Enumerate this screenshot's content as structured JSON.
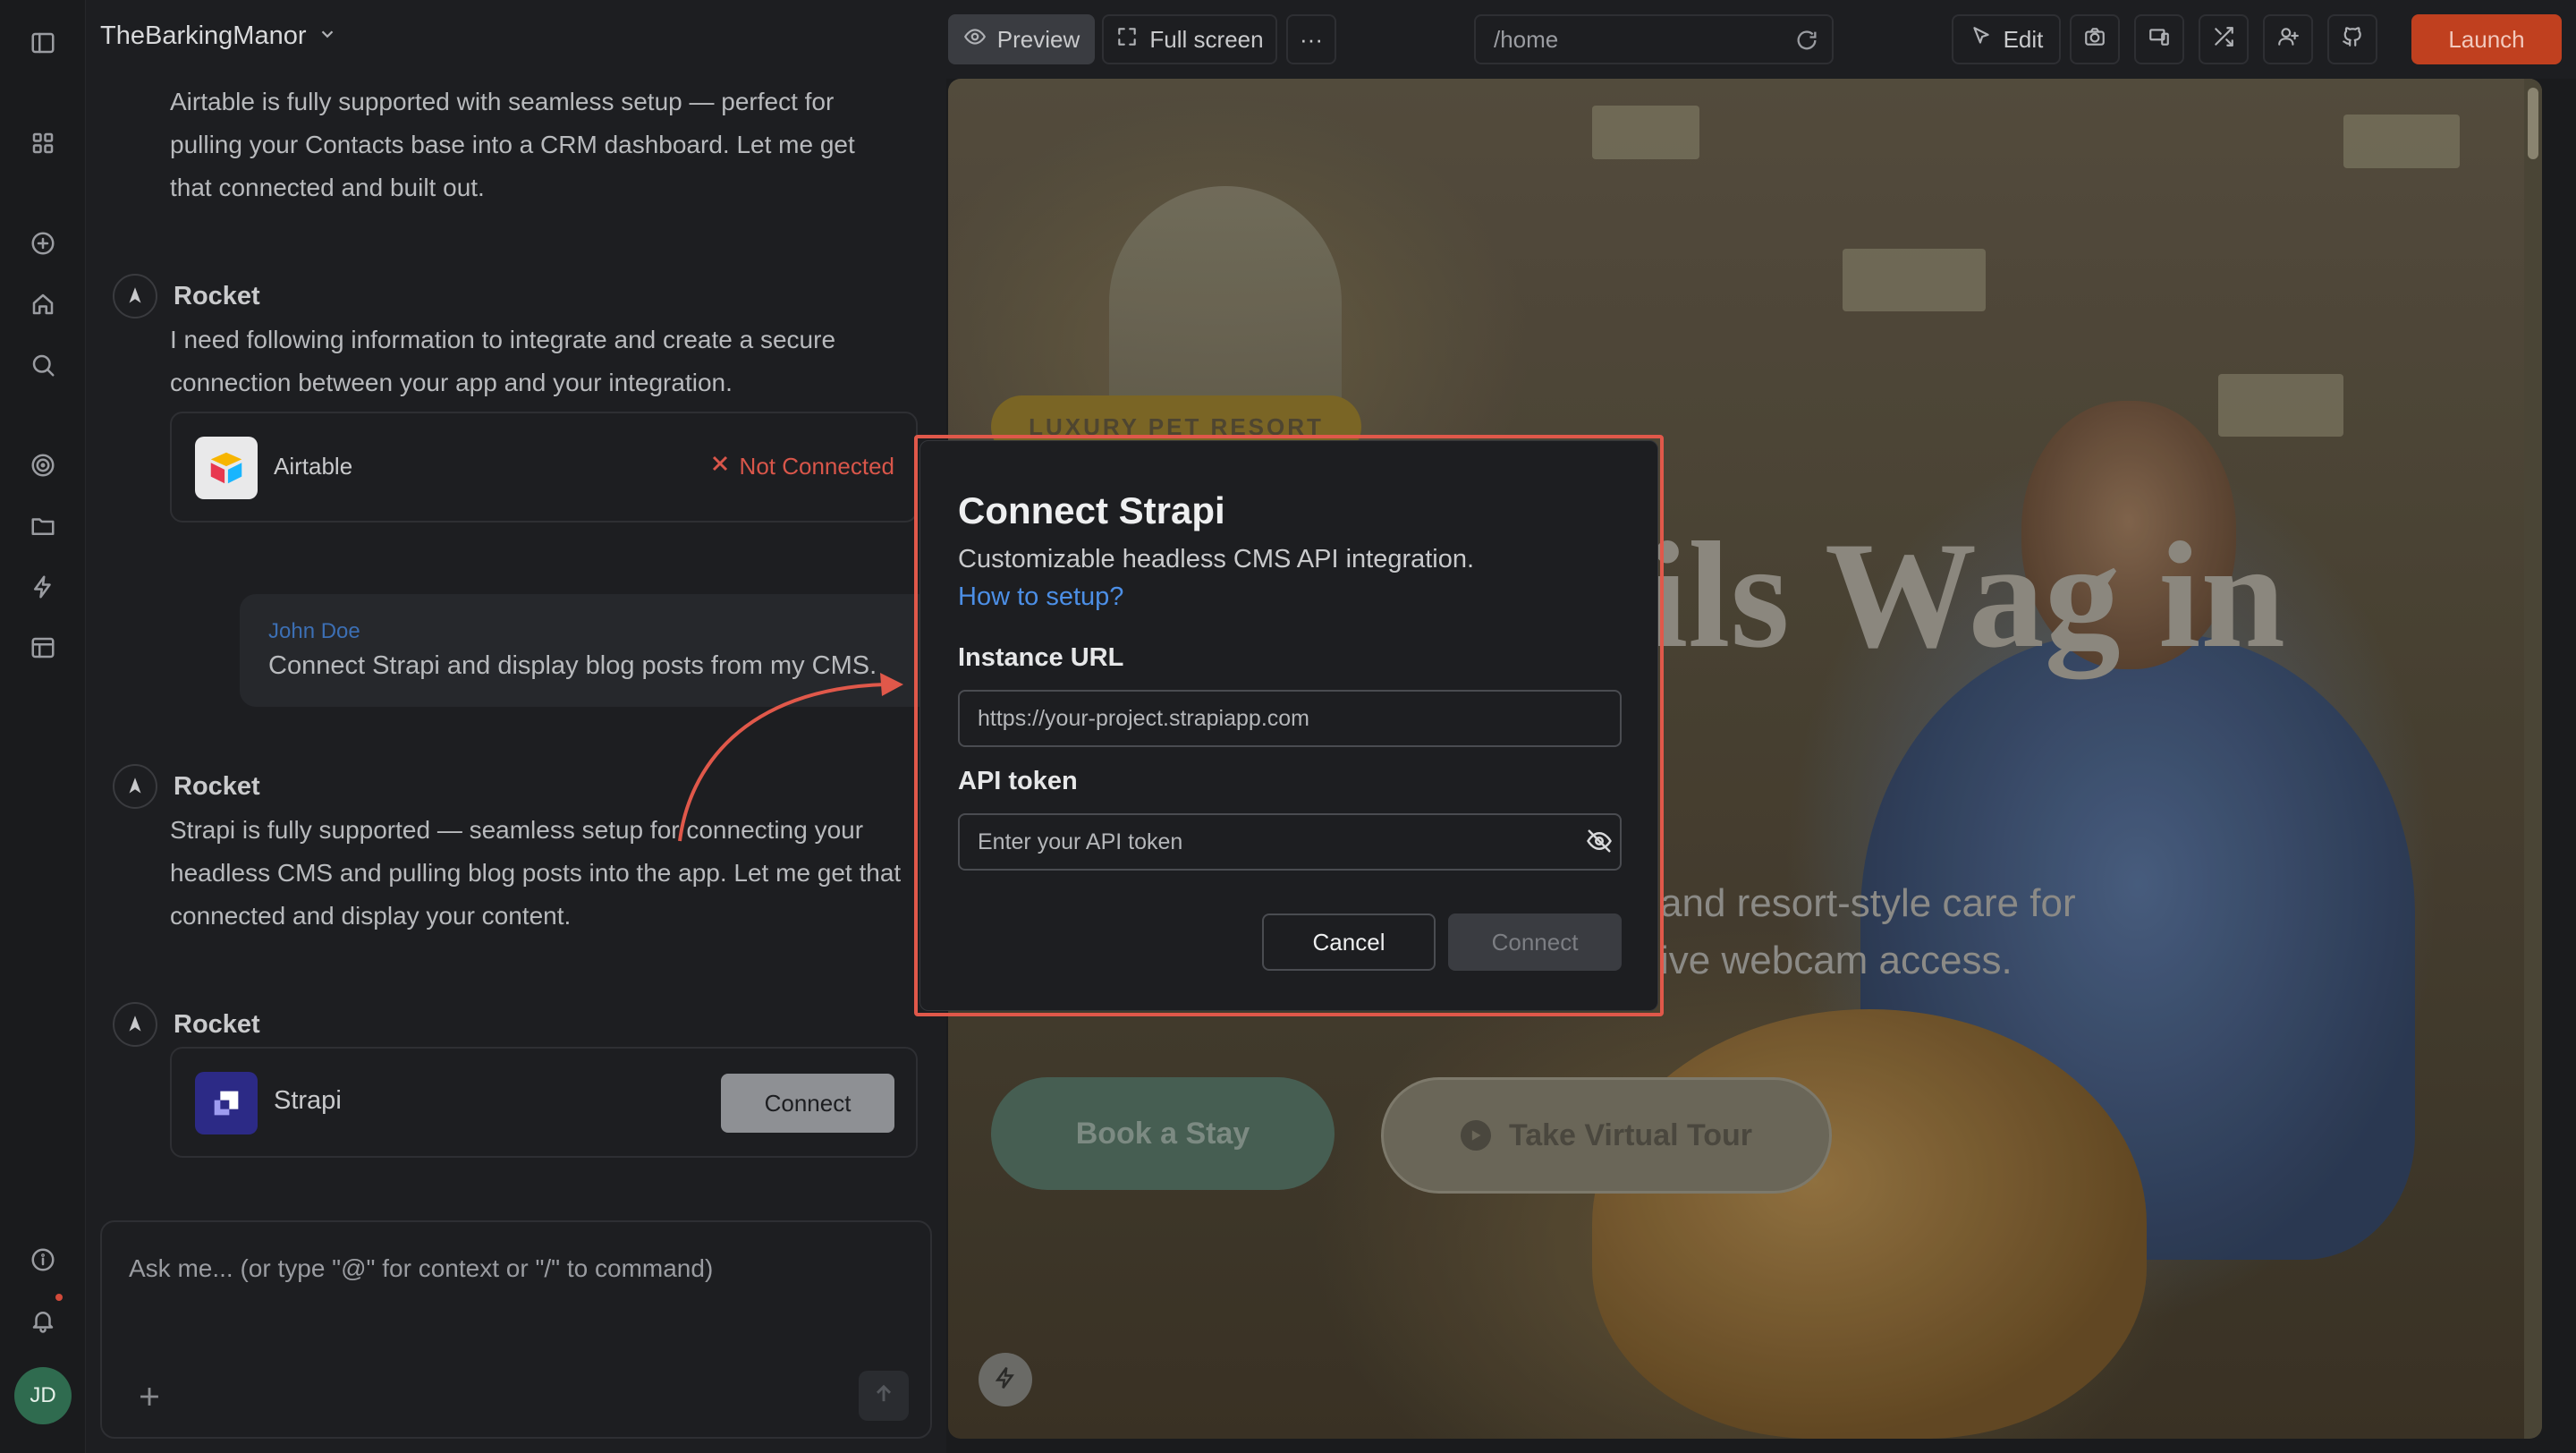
{
  "app": {
    "project_name": "TheBarkingManor",
    "user_initials": "JD"
  },
  "rail": {
    "icons": [
      "sidebar-toggle-icon",
      "grid-icon",
      "plus-circle-icon",
      "home-icon",
      "search-icon",
      "target-icon",
      "folder-icon",
      "bolt-icon",
      "layout-icon",
      "info-icon",
      "bell-icon"
    ]
  },
  "chat": {
    "messages": [
      {
        "type": "assistant_text",
        "text": "Airtable is fully supported with seamless setup — perfect for pulling your Contacts base into a CRM dashboard. Let me get that connected and built out."
      },
      {
        "type": "assistant",
        "author": "Rocket",
        "text": "I need following information to integrate and create a secure connection between your app and your integration."
      },
      {
        "type": "integration",
        "name": "Airtable",
        "status": "Not Connected"
      },
      {
        "type": "user",
        "author": "John Doe",
        "text": "Connect Strapi and display blog posts from my CMS."
      },
      {
        "type": "assistant",
        "author": "Rocket",
        "text": "Strapi is fully supported — seamless setup for connecting your headless CMS and pulling blog posts into the app. Let me get that connected and display your content."
      },
      {
        "type": "assistant",
        "author": "Rocket"
      },
      {
        "type": "integration",
        "name": "Strapi",
        "action": "Connect"
      }
    ],
    "composer_placeholder": "Ask me... (or type \"@\" for context or \"/\" to command)"
  },
  "topbar": {
    "preview_label": "Preview",
    "fullscreen_label": "Full screen",
    "more_label": "···",
    "url": "/home",
    "edit_label": "Edit",
    "launch_label": "Launch"
  },
  "preview": {
    "badge": "LUXURY PET RESORT",
    "hero_title": "ils Wag in",
    "hero_sub_line1": "and resort-style care for",
    "hero_sub_line2": "ive webcam access.",
    "cta_primary": "Book a Stay",
    "cta_secondary": "Take Virtual Tour"
  },
  "modal": {
    "title": "Connect Strapi",
    "description": "Customizable headless CMS API integration.",
    "help_link": "How to setup?",
    "instance_url_label": "Instance URL",
    "instance_url_placeholder": "https://your-project.strapiapp.com",
    "api_token_label": "API token",
    "api_token_placeholder": "Enter your API token",
    "cancel_label": "Cancel",
    "connect_label": "Connect"
  },
  "colors": {
    "accent_launch": "#c0401f",
    "link_blue": "#4c8fe6",
    "error_red": "#d9564a",
    "highlight_frame": "#e0584a"
  }
}
